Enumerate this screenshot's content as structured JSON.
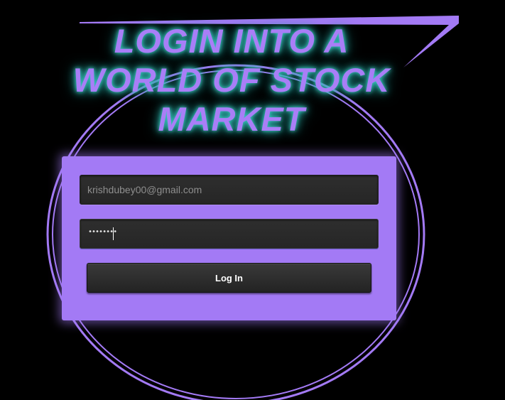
{
  "headline": {
    "line1": "LOGIN INTO A",
    "line2": "WORLD OF STOCK",
    "line3": "MARKET"
  },
  "login_form": {
    "email_value": "krishdubey00@gmail.com",
    "password_masked": "••••••••",
    "login_button_label": "Log In"
  },
  "colors": {
    "background": "#000000",
    "accent_purple": "#a37af5",
    "heading_glow": "#3fd0c9",
    "field_bg": "#2a2a2a"
  }
}
